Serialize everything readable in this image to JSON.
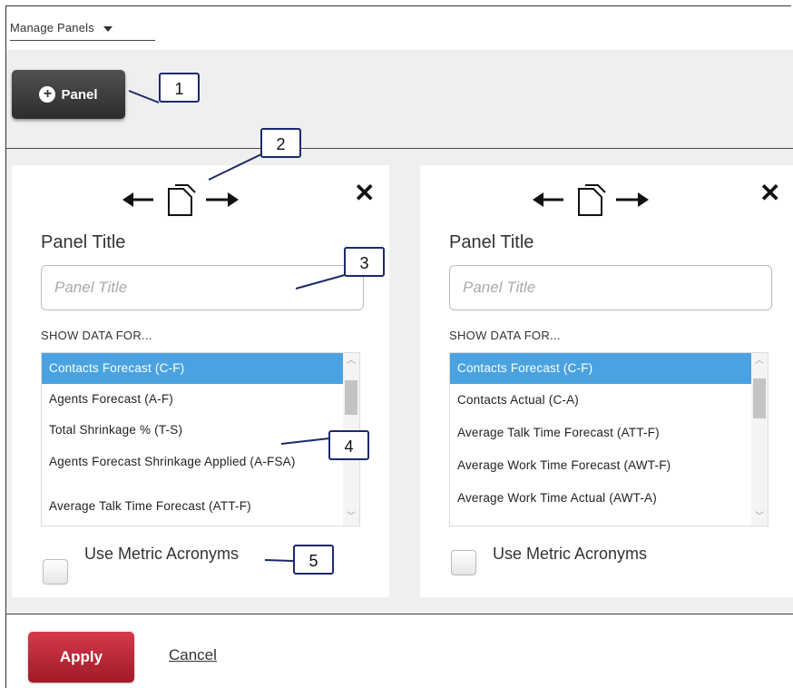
{
  "header": {
    "manage_panels_label": "Manage Panels"
  },
  "toolbar": {
    "add_panel_label": "Panel"
  },
  "panels": [
    {
      "title_label": "Panel Title",
      "title_placeholder": "Panel Title",
      "show_data_label": "SHOW DATA FOR...",
      "items": [
        "Contacts Forecast (C-F)",
        "Agents Forecast (A-F)",
        "Total Shrinkage % (T-S)",
        "Agents Forecast Shrinkage Applied (A-FSA)",
        "Average Talk Time Forecast (ATT-F)"
      ],
      "selected_index": 0,
      "checkbox_label": "Use Metric Acronyms"
    },
    {
      "title_label": "Panel Title",
      "title_placeholder": "Panel Title",
      "show_data_label": "SHOW DATA FOR...",
      "items": [
        "Contacts Forecast (C-F)",
        "Contacts Actual (C-A)",
        "Average Talk Time Forecast (ATT-F)",
        "Average Work Time Forecast (AWT-F)",
        "Average Work Time Actual (AWT-A)"
      ],
      "selected_index": 0,
      "checkbox_label": "Use Metric Acronyms"
    }
  ],
  "footer": {
    "apply_label": "Apply",
    "cancel_label": "Cancel"
  },
  "callouts": [
    "1",
    "2",
    "3",
    "4",
    "5"
  ],
  "colors": {
    "selected_item": "#4aa3e0",
    "apply_button": "#c0283a",
    "panel_button": "#3a3a3a",
    "callout_border": "#1b2a6b"
  },
  "icons": {
    "add": "plus-circle-icon",
    "move_left": "arrow-left-icon",
    "duplicate": "copy-icon",
    "move_right": "arrow-right-icon",
    "close": "close-icon"
  }
}
